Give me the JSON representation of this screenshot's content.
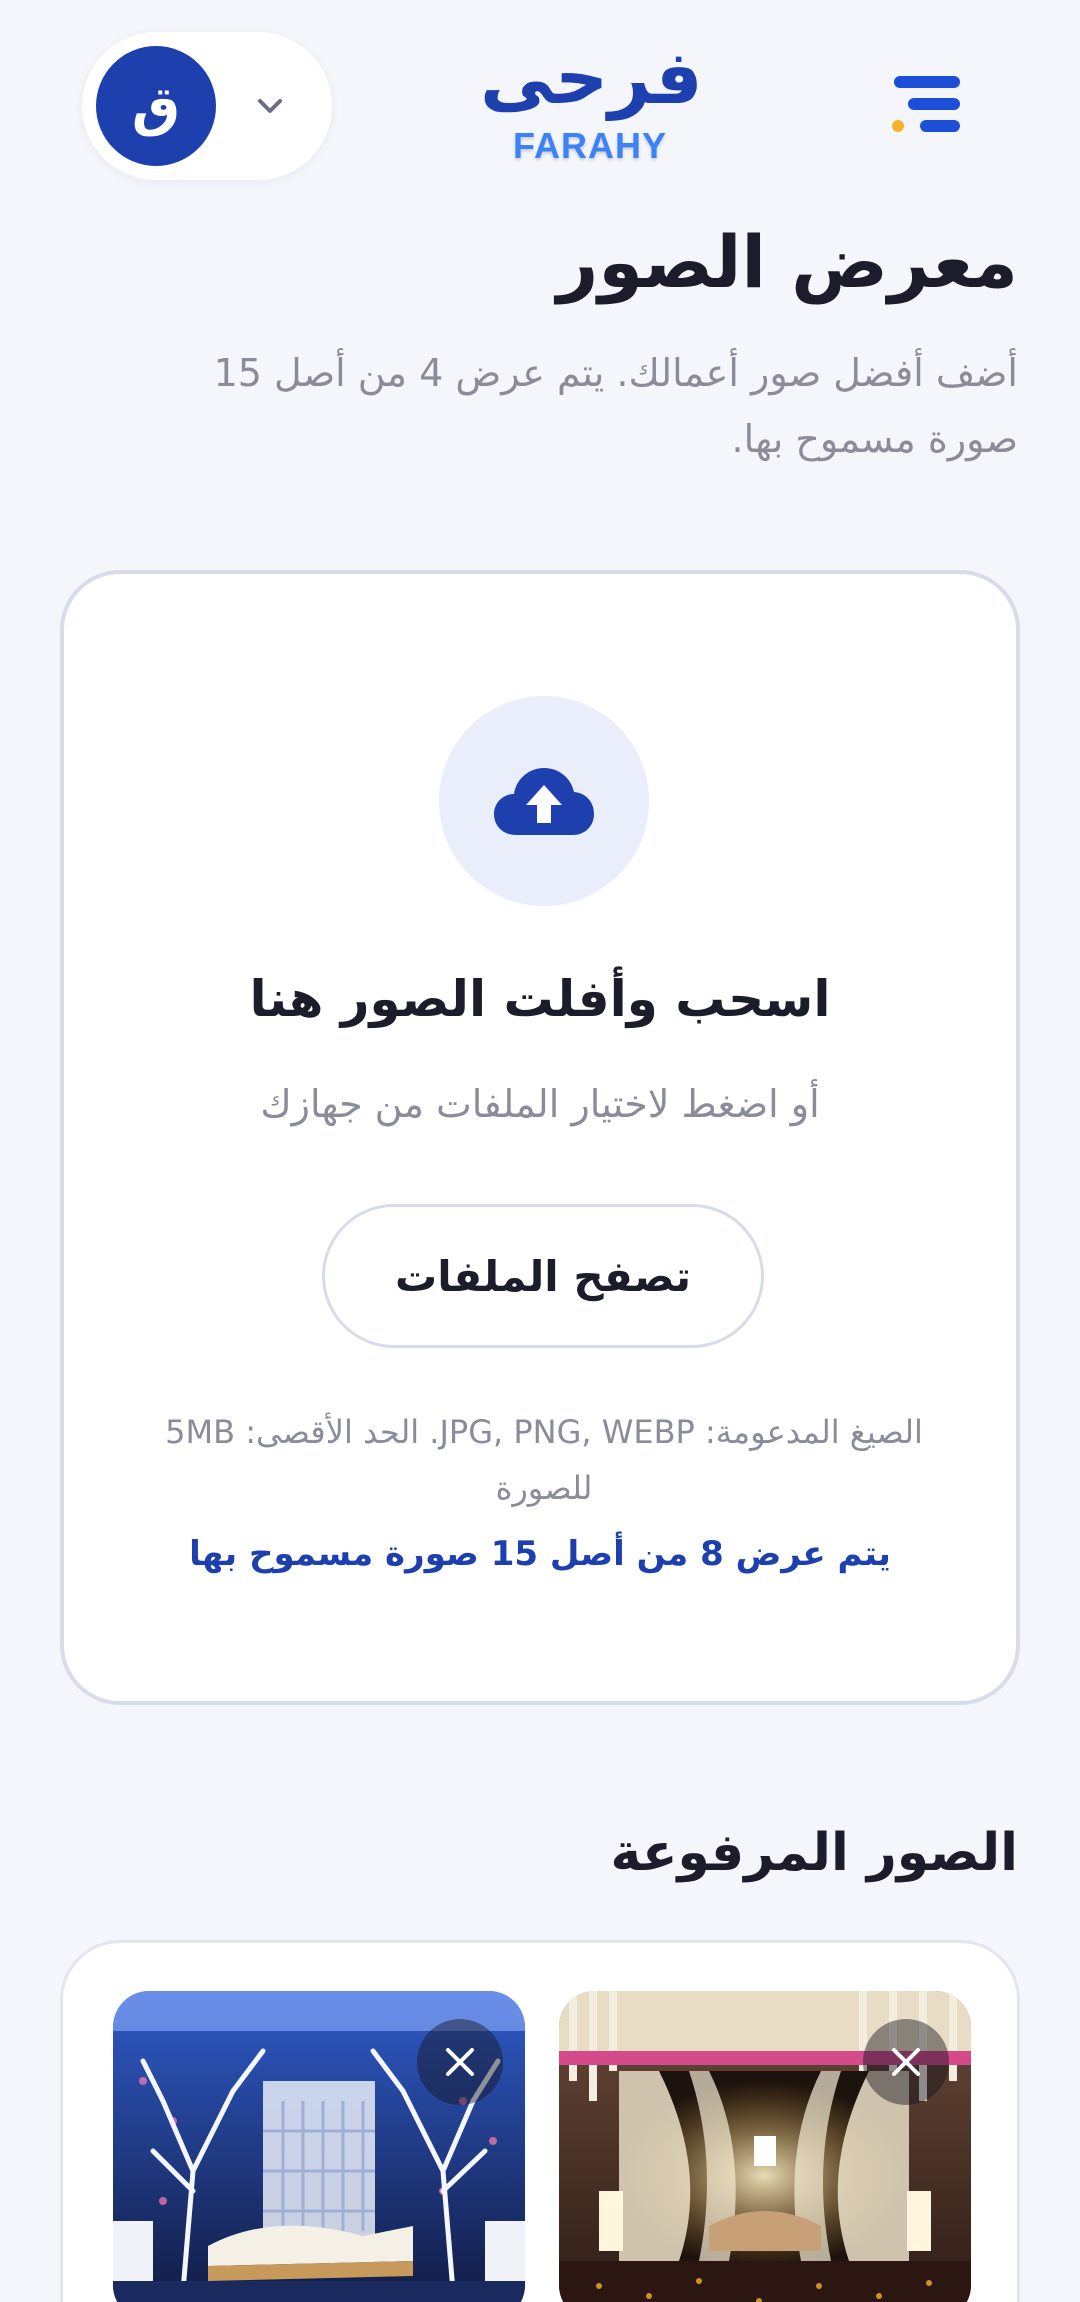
{
  "header": {
    "logo_ar": "فرحى",
    "logo_en": "FARAHY",
    "avatar_initial": "ق",
    "icons": [
      "menu-icon",
      "chevron-down-icon"
    ]
  },
  "page": {
    "title": "معرض الصور",
    "subtitle": "أضف أفضل صور أعمالك. يتم عرض 4 من أصل 15 صورة مسموح بها."
  },
  "upload": {
    "icon": "cloud-upload-icon",
    "drop_title": "اسحب وأفلت الصور هنا",
    "drop_subtitle": "أو اضغط لاختيار الملفات من جهازك",
    "browse_label": "تصفح الملفات",
    "formats_note": "الصيغ المدعومة: JPG, PNG, WEBP. الحد الأقصى: 5MB للصورة",
    "count_note": "يتم عرض 8 من أصل 15 صورة مسموح بها"
  },
  "uploaded": {
    "title": "الصور المرفوعة",
    "photos": [
      {
        "alt": "wedding stage with gold curtains",
        "remove_icon": "close-icon"
      },
      {
        "alt": "wedding stage with white trees",
        "remove_icon": "close-icon"
      }
    ]
  },
  "colors": {
    "brand": "#1e40af",
    "brand_light": "#3b82f6",
    "accent": "#f5b324",
    "background": "#f4f6fb"
  }
}
